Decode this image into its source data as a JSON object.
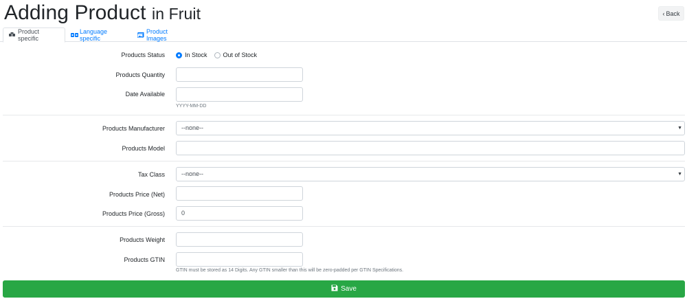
{
  "header": {
    "title": "Adding Product",
    "subtitle": "in Fruit",
    "back_label": "Back"
  },
  "tabs": [
    {
      "label": "Product specific",
      "icon": "boxes-icon",
      "active": true
    },
    {
      "label": "Language specific",
      "icon": "language-icon",
      "active": false
    },
    {
      "label": "Product Images",
      "icon": "images-icon",
      "active": false
    }
  ],
  "form": {
    "status": {
      "label": "Products Status",
      "options": [
        "In Stock",
        "Out of Stock"
      ],
      "selected": "In Stock"
    },
    "quantity": {
      "label": "Products Quantity",
      "value": ""
    },
    "date_available": {
      "label": "Date Available",
      "value": "",
      "help": "YYYY-MM-DD"
    },
    "manufacturer": {
      "label": "Products Manufacturer",
      "selected": "--none--"
    },
    "model": {
      "label": "Products Model",
      "value": ""
    },
    "tax_class": {
      "label": "Tax Class",
      "selected": "--none--"
    },
    "price_net": {
      "label": "Products Price (Net)",
      "value": ""
    },
    "price_gross": {
      "label": "Products Price (Gross)",
      "value": "0"
    },
    "weight": {
      "label": "Products Weight",
      "value": ""
    },
    "gtin": {
      "label": "Products GTIN",
      "value": "",
      "help": "GTIN must be stored as 14 Digits. Any GTIN smaller than this will be zero-padded per GTIN Specifications."
    }
  },
  "save_label": "Save",
  "colors": {
    "primary": "#007bff",
    "success": "#28a745",
    "border": "#ced4da"
  }
}
